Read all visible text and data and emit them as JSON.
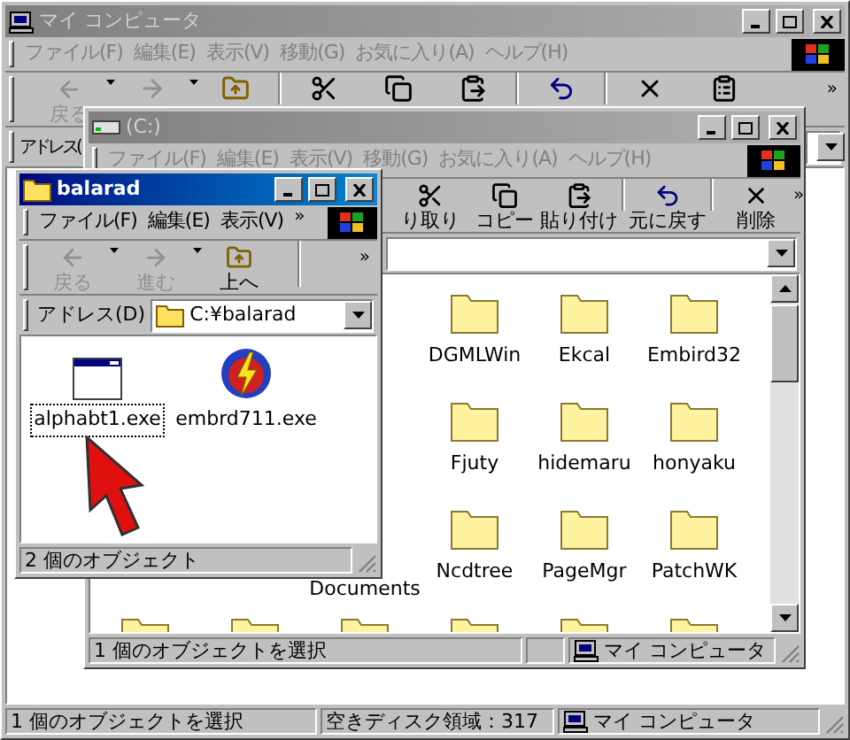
{
  "windows": [
    {
      "kind": "computer",
      "title": "マイ コンピュータ",
      "active": false,
      "menu": [
        "ファイル(F)",
        "編集(E)",
        "表示(V)",
        "移動(G)",
        "お気に入り(A)",
        "ヘルプ(H)"
      ],
      "toolbar": [
        {
          "kind": "back",
          "label": "戻る",
          "disabled": true
        },
        {
          "kind": "forward",
          "disabled": true
        },
        {
          "kind": "up",
          "disabled": false
        },
        {
          "kind": "cut",
          "disabled": false
        },
        {
          "kind": "copy",
          "disabled": false
        },
        {
          "kind": "paste",
          "disabled": false
        },
        {
          "kind": "undo",
          "disabled": false
        },
        {
          "kind": "delete",
          "disabled": false
        },
        {
          "kind": "properties",
          "disabled": false
        }
      ],
      "toolbar_more": "»",
      "address_label": "アドレス(",
      "status": [
        {
          "text": "1 個のオブジェクトを選択"
        },
        {
          "text": "空きディスク領域：317"
        },
        {
          "kind": "computer",
          "text": "マイ コンピュータ"
        }
      ]
    },
    {
      "kind": "drive",
      "title": "(C:)",
      "active": false,
      "menu": [
        "ファイル(F)",
        "編集(E)",
        "表示(V)",
        "移動(G)",
        "お気に入り(A)",
        "ヘルプ(H)"
      ],
      "toolbar": [
        {
          "kind": "cut",
          "label": "り取り",
          "disabled": false
        },
        {
          "kind": "copy",
          "label": "コピー",
          "disabled": false
        },
        {
          "kind": "paste",
          "label": "貼り付け",
          "disabled": false
        },
        {
          "kind": "undo",
          "label": "元に戻す",
          "disabled": false
        },
        {
          "kind": "delete",
          "label": "削除",
          "disabled": false
        }
      ],
      "toolbar_more": "»",
      "folders": [
        [
          {
            "kind": "folder",
            "label": "DGMLWin"
          },
          {
            "kind": "folder",
            "label": "Ekcal"
          },
          {
            "kind": "folder",
            "label": "Embird32"
          }
        ],
        [
          {
            "kind": "folder",
            "label": "Fjuty"
          },
          {
            "kind": "folder",
            "label": "hidemaru"
          },
          {
            "kind": "folder",
            "label": "honyaku"
          }
        ],
        [
          {
            "kind": "label",
            "label": "Documents"
          },
          {
            "kind": "folder",
            "label": "Ncdtree"
          },
          {
            "kind": "folder",
            "label": "PageMgr"
          },
          {
            "kind": "folder",
            "label": "PatchWK"
          }
        ],
        [
          {
            "kind": "folder"
          },
          {
            "kind": "folder"
          },
          {
            "kind": "folder"
          },
          {
            "kind": "folder"
          },
          {
            "kind": "folder"
          },
          {
            "kind": "folder"
          }
        ]
      ],
      "status": [
        {
          "text": "1 個のオブジェクトを選択"
        },
        {
          "kind": "blank"
        },
        {
          "kind": "computer",
          "text": "マイ コンピュータ"
        }
      ]
    },
    {
      "kind": "folder",
      "title": "balarad",
      "active": true,
      "menu": [
        "ファイル(F)",
        "編集(E)",
        "表示(V)"
      ],
      "menu_more": "»",
      "toolbar": [
        {
          "kind": "back",
          "label": "戻る",
          "disabled": true
        },
        {
          "kind": "forward",
          "label": "進む",
          "disabled": true
        },
        {
          "kind": "up",
          "label": "上へ",
          "disabled": false
        }
      ],
      "toolbar_more": "»",
      "address_label": "アドレス(D)",
      "address_value": "C:¥balarad",
      "files": [
        {
          "kind": "app",
          "label": "alphabt1.exe",
          "selected": true
        },
        {
          "kind": "badge",
          "label": "embrd711.exe",
          "selected": false
        }
      ],
      "status": [
        {
          "text": "2 個のオブジェクト"
        }
      ]
    }
  ]
}
